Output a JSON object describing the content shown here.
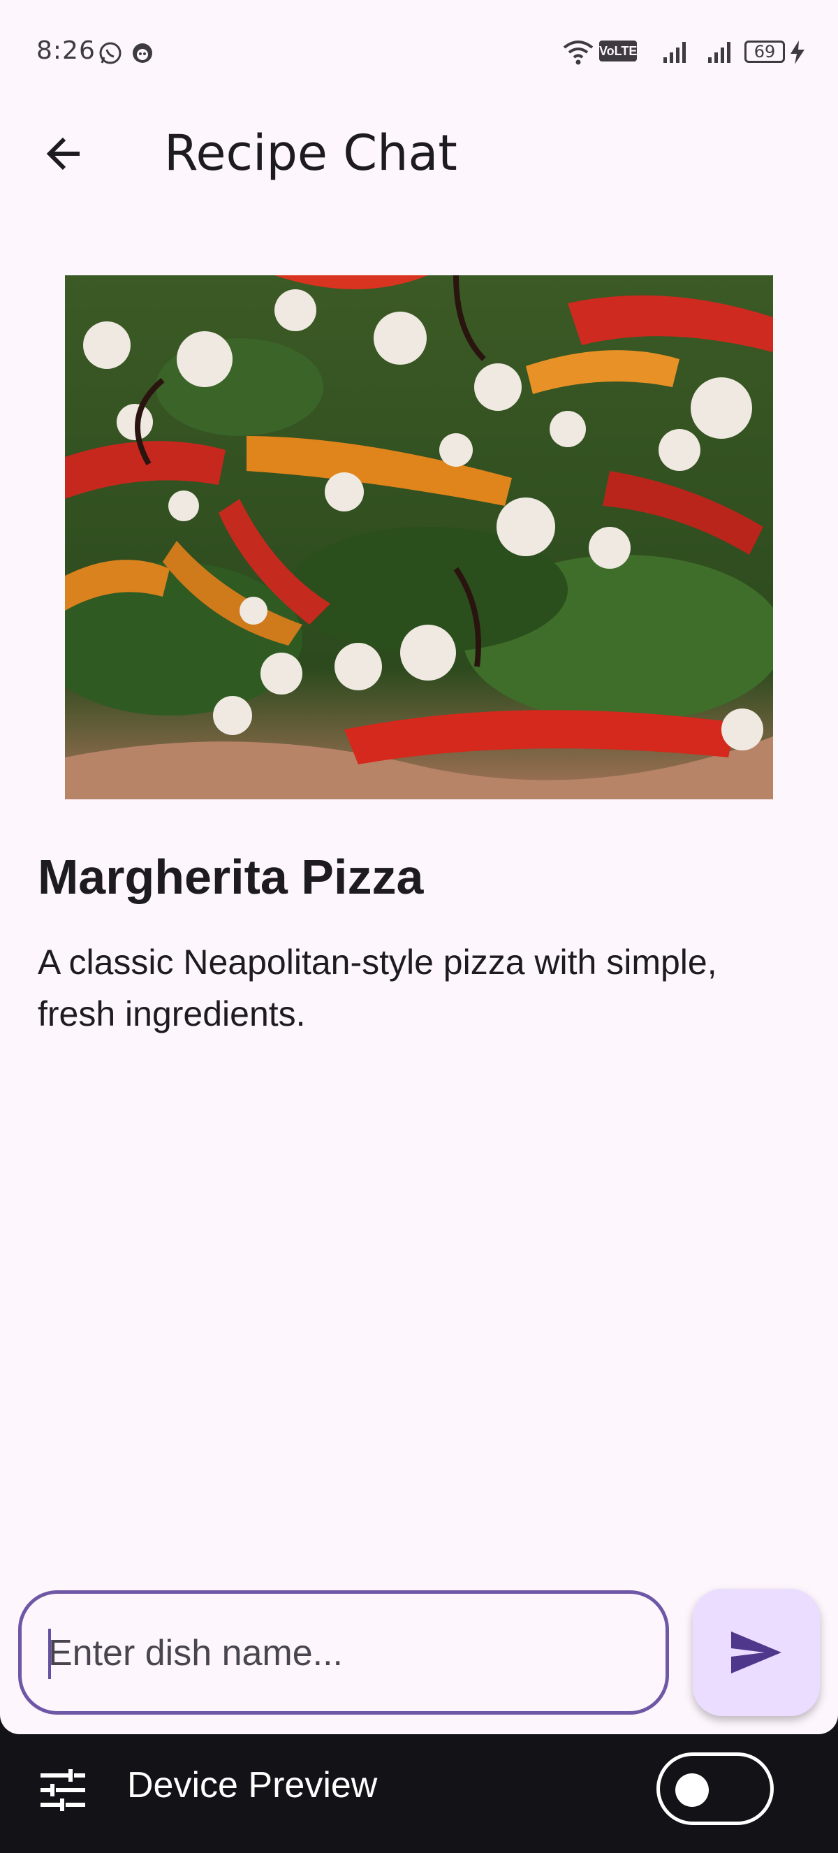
{
  "status_bar": {
    "time": "8:26",
    "battery": "69",
    "network_badge": "VoLTE"
  },
  "app_bar": {
    "title": "Recipe Chat"
  },
  "recipe": {
    "name": "Margherita Pizza",
    "description": "A classic Neapolitan-style pizza with simple, fresh ingredients."
  },
  "composer": {
    "placeholder": "Enter dish name...",
    "value": ""
  },
  "device_preview": {
    "label": "Device Preview",
    "toggle_on": false
  },
  "colors": {
    "background": "#fdf6fd",
    "accent": "#6750a4",
    "send_button": "#eaddff",
    "preview_bar": "#131217"
  }
}
